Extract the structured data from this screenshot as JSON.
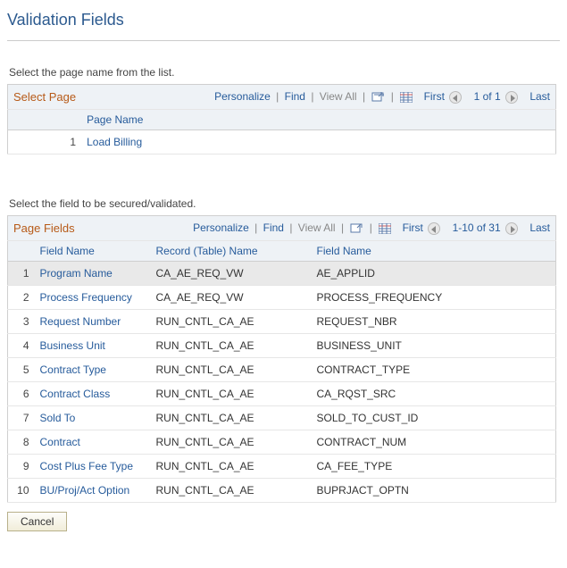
{
  "page_title": "Validation Fields",
  "select_page": {
    "prompt": "Select the page name from the list.",
    "grid_title": "Select Page",
    "tools": {
      "personalize": "Personalize",
      "find": "Find",
      "view_all": "View All"
    },
    "nav": {
      "first": "First",
      "range": "1 of 1",
      "last": "Last"
    },
    "columns": {
      "page_name": "Page Name"
    },
    "rows": [
      {
        "n": "1",
        "page_name": "Load Billing"
      }
    ]
  },
  "page_fields": {
    "prompt": "Select the field to be secured/validated.",
    "grid_title": "Page Fields",
    "tools": {
      "personalize": "Personalize",
      "find": "Find",
      "view_all": "View All"
    },
    "nav": {
      "first": "First",
      "range": "1-10 of 31",
      "last": "Last"
    },
    "columns": {
      "field_label": "Field Name",
      "record_name": "Record (Table) Name",
      "field_name": "Field Name"
    },
    "rows": [
      {
        "n": "1",
        "field_label": "Program Name",
        "record_name": "CA_AE_REQ_VW",
        "field_name": "AE_APPLID"
      },
      {
        "n": "2",
        "field_label": "Process Frequency",
        "record_name": "CA_AE_REQ_VW",
        "field_name": "PROCESS_FREQUENCY"
      },
      {
        "n": "3",
        "field_label": "Request Number",
        "record_name": "RUN_CNTL_CA_AE",
        "field_name": "REQUEST_NBR"
      },
      {
        "n": "4",
        "field_label": "Business Unit",
        "record_name": "RUN_CNTL_CA_AE",
        "field_name": "BUSINESS_UNIT"
      },
      {
        "n": "5",
        "field_label": "Contract Type",
        "record_name": "RUN_CNTL_CA_AE",
        "field_name": "CONTRACT_TYPE"
      },
      {
        "n": "6",
        "field_label": "Contract Class",
        "record_name": "RUN_CNTL_CA_AE",
        "field_name": "CA_RQST_SRC"
      },
      {
        "n": "7",
        "field_label": "Sold To",
        "record_name": "RUN_CNTL_CA_AE",
        "field_name": "SOLD_TO_CUST_ID"
      },
      {
        "n": "8",
        "field_label": "Contract",
        "record_name": "RUN_CNTL_CA_AE",
        "field_name": "CONTRACT_NUM"
      },
      {
        "n": "9",
        "field_label": "Cost Plus Fee Type",
        "record_name": "RUN_CNTL_CA_AE",
        "field_name": "CA_FEE_TYPE"
      },
      {
        "n": "10",
        "field_label": "BU/Proj/Act Option",
        "record_name": "RUN_CNTL_CA_AE",
        "field_name": "BUPRJACT_OPTN"
      }
    ]
  },
  "buttons": {
    "cancel": "Cancel"
  }
}
